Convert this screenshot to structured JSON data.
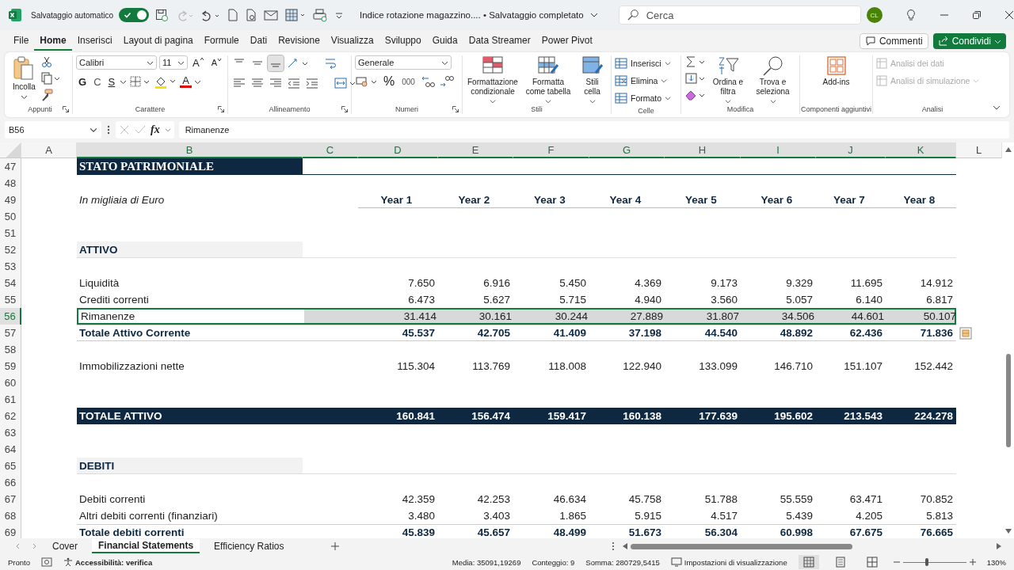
{
  "titlebar": {
    "autosave_label": "Salvataggio automatico",
    "autosave_on": true,
    "doc_title": "Indice rotazione magazzino.... • Salvataggio completato",
    "search_placeholder": "Cerca",
    "avatar": "CL"
  },
  "menu_tabs": [
    {
      "label": "File",
      "selected": false
    },
    {
      "label": "Home",
      "selected": true
    },
    {
      "label": "Inserisci",
      "selected": false
    },
    {
      "label": "Layout di pagina",
      "selected": false
    },
    {
      "label": "Formule",
      "selected": false
    },
    {
      "label": "Dati",
      "selected": false
    },
    {
      "label": "Revisione",
      "selected": false
    },
    {
      "label": "Visualizza",
      "selected": false
    },
    {
      "label": "Sviluppo",
      "selected": false
    },
    {
      "label": "Guida",
      "selected": false
    },
    {
      "label": "Data Streamer",
      "selected": false
    },
    {
      "label": "Power Pivot",
      "selected": false
    }
  ],
  "comments_button": "Commenti",
  "share_button": "Condividi",
  "ribbon": {
    "appunti": {
      "label": "Appunti",
      "paste": "Incolla"
    },
    "carattere": {
      "label": "Carattere",
      "font": "Calibri",
      "size": "11",
      "grow": "A",
      "shrink": "A",
      "bold": "G",
      "italic": "C",
      "underline": "S",
      "font_color_letter": "A"
    },
    "allineamento": {
      "label": "Allineamento",
      "vertical": [
        {
          "selected": false
        },
        {
          "selected": false
        },
        {
          "selected": true
        }
      ]
    },
    "numeri": {
      "label": "Numeri",
      "format": "Generale",
      "percent": "%",
      "thousands": "000"
    },
    "stili": {
      "label": "Stili",
      "buttons": [
        "Formattazione condizionale",
        "Formatta come tabella",
        "Stili cella"
      ]
    },
    "celle": {
      "label": "Celle",
      "buttons": [
        "Inserisci",
        "Elimina",
        "Formato"
      ]
    },
    "modifica": {
      "label": "Modifica",
      "buttons": [
        "Ordina e filtra",
        "Trova e seleziona"
      ]
    },
    "componenti": {
      "label": "Componenti aggiuntivi",
      "button": "Add-ins"
    },
    "analisi": {
      "label": "Analisi",
      "buttons": [
        {
          "label": "Analisi dei dati",
          "disabled": true
        },
        {
          "label": "Analisi di simulazione",
          "disabled": true
        }
      ]
    }
  },
  "formula_bar": {
    "name_box": "B56",
    "fx": "fx",
    "formula": "Rimanenze"
  },
  "columns": [
    {
      "label": "A",
      "selected": false
    },
    {
      "label": "B",
      "selected": true
    },
    {
      "label": "C",
      "selected": true
    },
    {
      "label": "D",
      "selected": true
    },
    {
      "label": "E",
      "selected": true
    },
    {
      "label": "F",
      "selected": true
    },
    {
      "label": "G",
      "selected": true
    },
    {
      "label": "H",
      "selected": true
    },
    {
      "label": "I",
      "selected": true
    },
    {
      "label": "J",
      "selected": true
    },
    {
      "label": "K",
      "selected": true
    },
    {
      "label": "L",
      "selected": false
    }
  ],
  "rows": [
    {
      "number": "47",
      "kind": "title",
      "label": "STATO PATRIMONIALE",
      "selected": false
    },
    {
      "number": "48",
      "kind": "blank",
      "selected": false
    },
    {
      "number": "49",
      "kind": "header",
      "label": "In migliaia di Euro",
      "values": [
        "Year 1",
        "Year 2",
        "Year 3",
        "Year 4",
        "Year 5",
        "Year 6",
        "Year 7",
        "Year 8"
      ],
      "selected": false
    },
    {
      "number": "50",
      "kind": "blank",
      "selected": false
    },
    {
      "number": "51",
      "kind": "blank",
      "selected": false
    },
    {
      "number": "52",
      "kind": "section",
      "label": "ATTIVO",
      "selected": false
    },
    {
      "number": "53",
      "kind": "blank",
      "selected": false
    },
    {
      "number": "54",
      "kind": "item",
      "label": "Liquidità",
      "values": [
        "7.650",
        "6.916",
        "5.450",
        "4.369",
        "9.173",
        "9.329",
        "11.695",
        "14.912"
      ],
      "selected": false
    },
    {
      "number": "55",
      "kind": "item",
      "label": "Crediti correnti",
      "values": [
        "6.473",
        "5.627",
        "5.715",
        "4.940",
        "3.560",
        "5.057",
        "6.140",
        "6.817"
      ],
      "selected": false
    },
    {
      "number": "56",
      "kind": "item",
      "label": "Rimanenze",
      "values": [
        "31.414",
        "30.161",
        "30.244",
        "27.889",
        "31.807",
        "34.506",
        "44.601",
        "50.107"
      ],
      "selected": true
    },
    {
      "number": "57",
      "kind": "total",
      "label": "Totale Attivo Corrente",
      "values": [
        "45.537",
        "42.705",
        "41.409",
        "37.198",
        "44.540",
        "48.892",
        "62.436",
        "71.836"
      ],
      "selected": false
    },
    {
      "number": "58",
      "kind": "blank",
      "selected": false
    },
    {
      "number": "59",
      "kind": "item",
      "label": "Immobilizzazioni nette",
      "values": [
        "115.304",
        "113.769",
        "118.008",
        "122.940",
        "133.099",
        "146.710",
        "151.107",
        "152.442"
      ],
      "selected": false
    },
    {
      "number": "60",
      "kind": "blank",
      "selected": false
    },
    {
      "number": "61",
      "kind": "blank",
      "selected": false
    },
    {
      "number": "62",
      "kind": "grand",
      "label": "TOTALE ATTIVO",
      "values": [
        "160.841",
        "156.474",
        "159.417",
        "160.138",
        "177.639",
        "195.602",
        "213.543",
        "224.278"
      ],
      "selected": false
    },
    {
      "number": "63",
      "kind": "blank",
      "selected": false
    },
    {
      "number": "64",
      "kind": "blank",
      "selected": false
    },
    {
      "number": "65",
      "kind": "section",
      "label": "DEBITI",
      "selected": false
    },
    {
      "number": "66",
      "kind": "blank",
      "selected": false
    },
    {
      "number": "67",
      "kind": "item",
      "label": "Debiti correnti",
      "values": [
        "42.359",
        "42.253",
        "46.634",
        "45.758",
        "51.788",
        "55.559",
        "63.471",
        "70.852"
      ],
      "selected": false
    },
    {
      "number": "68",
      "kind": "item",
      "label": "Altri debiti correnti (finanziari)",
      "values": [
        "3.480",
        "3.403",
        "1.865",
        "5.915",
        "4.517",
        "5.439",
        "4.205",
        "5.813"
      ],
      "selected": false
    },
    {
      "number": "69",
      "kind": "total",
      "label": "Totale debiti correnti",
      "values": [
        "45.839",
        "45.657",
        "48.499",
        "51.673",
        "56.304",
        "60.998",
        "67.675",
        "76.665"
      ],
      "selected": false
    }
  ],
  "sheet_tabs": [
    {
      "label": "Cover",
      "selected": false
    },
    {
      "label": "Financial Statements",
      "selected": true
    },
    {
      "label": "Efficiency Ratios",
      "selected": false
    }
  ],
  "status_bar": {
    "mode": "Pronto",
    "accessibility": "Accessibilità: verifica",
    "average": "Media: 35091,19269",
    "count": "Conteggio: 9",
    "sum": "Somma: 280729,5415",
    "display_settings": "Impostazioni di visualizzazione",
    "zoom": "130%",
    "zoom_level": {
      "level": 0.35
    }
  }
}
